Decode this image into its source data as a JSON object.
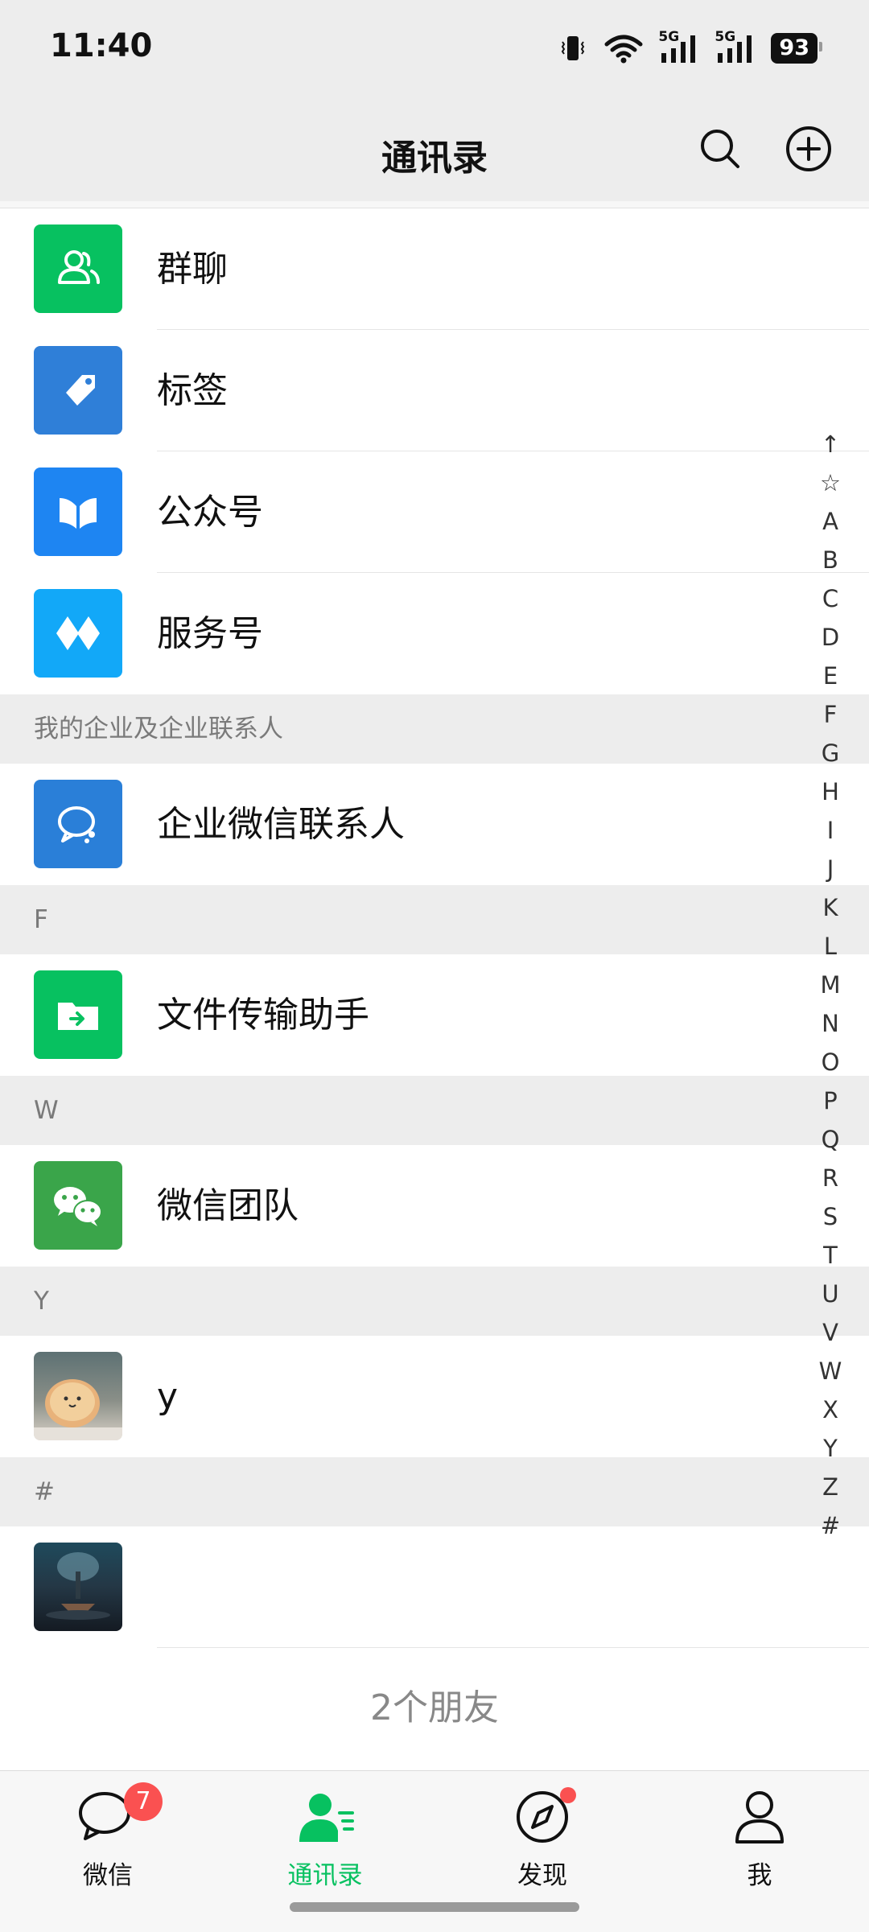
{
  "status_bar": {
    "time": "11:40",
    "signal_1_label": "5G",
    "signal_2_label": "5G",
    "battery": "93"
  },
  "nav": {
    "title": "通讯录",
    "search_icon": "search-icon",
    "add_icon": "plus-circle-icon"
  },
  "features": [
    {
      "label": "群聊",
      "icon": "group-chat-icon",
      "color": "#07c160"
    },
    {
      "label": "标签",
      "icon": "tag-icon",
      "color": "#2f7fd8"
    },
    {
      "label": "公众号",
      "icon": "official-account-icon",
      "color": "#1e85f2"
    },
    {
      "label": "服务号",
      "icon": "service-account-icon",
      "color": "#12a8f8"
    }
  ],
  "sections": {
    "enterprise_header": "我的企业及企业联系人",
    "enterprise_item": {
      "label": "企业微信联系人",
      "icon": "wecom-icon",
      "color": "#2a7fd8"
    },
    "f_header": "F",
    "f_item": {
      "label": "文件传输助手",
      "icon": "file-transfer-icon",
      "color": "#07c160"
    },
    "w_header": "W",
    "w_item": {
      "label": "微信团队",
      "icon": "wechat-team-icon",
      "color": "#3aa54a"
    },
    "y_header": "Y",
    "y_item": {
      "label": "y",
      "icon": "bread-avatar"
    },
    "hash_header": "#",
    "hash_item": {
      "label": "",
      "icon": "dark-scene-avatar"
    }
  },
  "footer_count": "2个朋友",
  "index_letters": [
    "↑",
    "☆",
    "A",
    "B",
    "C",
    "D",
    "E",
    "F",
    "G",
    "H",
    "I",
    "J",
    "K",
    "L",
    "M",
    "N",
    "O",
    "P",
    "Q",
    "R",
    "S",
    "T",
    "U",
    "V",
    "W",
    "X",
    "Y",
    "Z",
    "#"
  ],
  "tabs": [
    {
      "label": "微信",
      "icon": "chat-bubble-icon",
      "badge": "7",
      "active": false
    },
    {
      "label": "通讯录",
      "icon": "contacts-icon",
      "active": true
    },
    {
      "label": "发现",
      "icon": "compass-icon",
      "dot": true,
      "active": false
    },
    {
      "label": "我",
      "icon": "person-icon",
      "active": false
    }
  ],
  "colors": {
    "accent": "#07c160",
    "badge": "#fa5151",
    "background": "#ededed"
  }
}
